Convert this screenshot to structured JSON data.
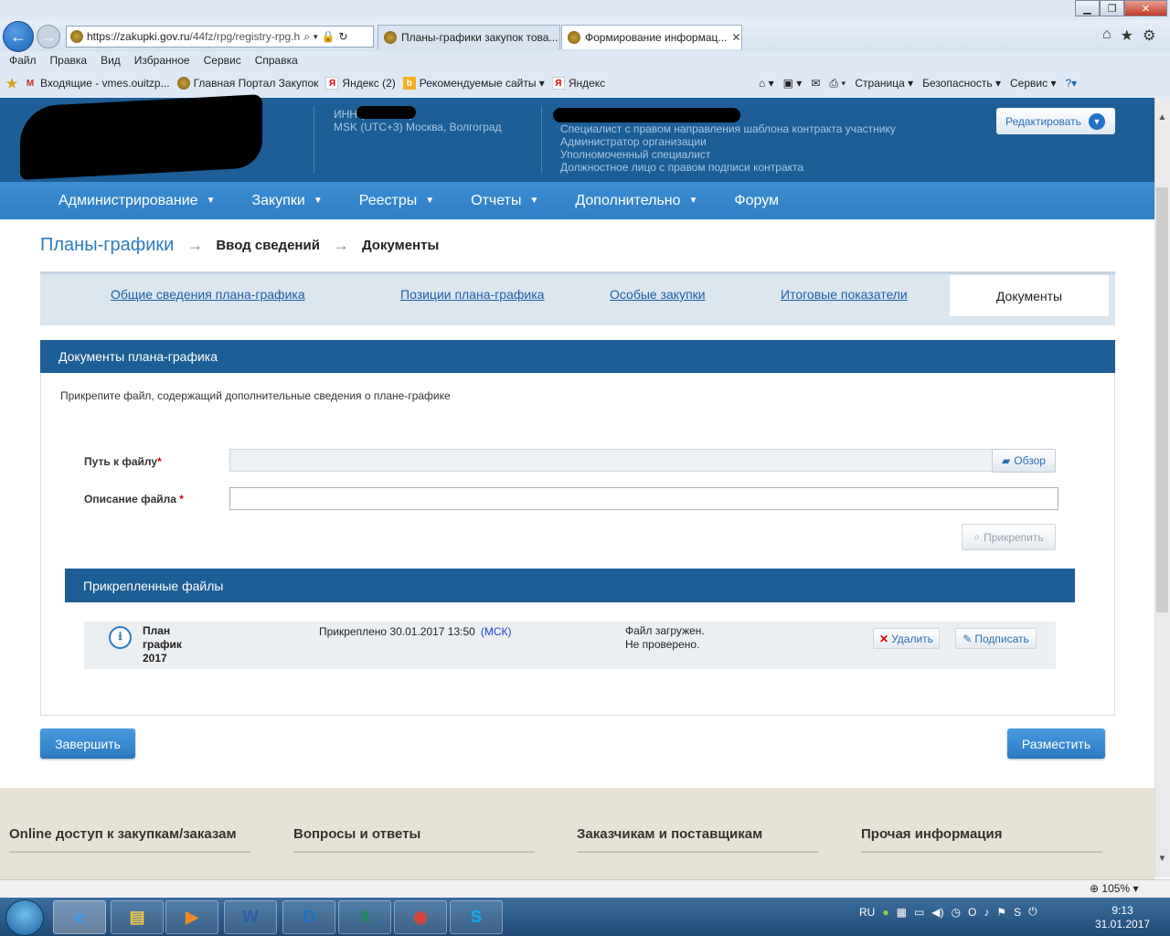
{
  "browser": {
    "url_host": "https://zakupki.gov.ru",
    "url_path": "/44fz/rpg/registry-rpg.h",
    "tabs": [
      {
        "title": "Планы-графики закупок това..."
      },
      {
        "title": "Формирование информац..."
      }
    ],
    "menu": [
      "Файл",
      "Правка",
      "Вид",
      "Избранное",
      "Сервис",
      "Справка"
    ],
    "favorites": [
      {
        "label": "Входящие - vmes.ouitzp...",
        "icon": "gmail-icon"
      },
      {
        "label": "Главная Портал Закупок",
        "icon": "emblem-icon"
      },
      {
        "label": "Яндекс (2)",
        "icon": "yandex-icon"
      },
      {
        "label": "Рекомендуемые сайты ▾",
        "icon": "bing-icon"
      },
      {
        "label": "Яндекс",
        "icon": "yandex-icon"
      }
    ],
    "commands": [
      "Страница ▾",
      "Безопасность ▾",
      "Сервис ▾"
    ],
    "zoom": "105%"
  },
  "header": {
    "org_line1": "ИНН                (Заказчик)",
    "org_line2": "MSK (UTC+3) Москва, Волгоград",
    "roles": [
      "Специалист с правом направления шаблона контракта участнику",
      "Администратор организации",
      "Уполномоченный специалист",
      "Должностное лицо с правом подписи контракта"
    ],
    "edit_label": "Редактировать"
  },
  "nav": {
    "items": [
      {
        "label": "Администрирование",
        "caret": true
      },
      {
        "label": "Закупки",
        "caret": true
      },
      {
        "label": "Реестры",
        "caret": true
      },
      {
        "label": "Отчеты",
        "caret": true
      },
      {
        "label": "Дополнительно",
        "caret": true
      },
      {
        "label": "Форум",
        "caret": false
      }
    ]
  },
  "breadcrumb": {
    "root": "Планы-графики",
    "step1": "Ввод сведений",
    "step2": "Документы"
  },
  "page_tabs": {
    "general": "Общие сведения плана-графика",
    "positions": "Позиции плана-графика",
    "special": "Особые закупки",
    "totals": "Итоговые показатели",
    "documents": "Документы"
  },
  "panel": {
    "title": "Документы плана-графика",
    "hint": "Прикрепите файл, содержащий дополнительные сведения о плане-графике",
    "file_path_label": "Путь к файлу",
    "file_desc_label": "Описание файла",
    "required_mark": "*",
    "browse_label": "Обзор",
    "attach_label": "Прикрепить",
    "attached_title": "Прикрепленные файлы"
  },
  "attached_files": [
    {
      "name": "План график 2017",
      "attached_text": "Прикреплено 30.01.2017 13:50",
      "tz": "(МСК)",
      "status": "Файл загружен. Не проверено.",
      "delete_label": "Удалить",
      "sign_label": "Подписать"
    }
  ],
  "actions": {
    "finish_label": "Завершить",
    "place_label": "Разместить"
  },
  "footer": {
    "cols": [
      "Online доступ к закупкам/заказам",
      "Вопросы и ответы",
      "Заказчикам и поставщикам",
      "Прочая информация"
    ]
  },
  "taskbar": {
    "lang": "RU",
    "time": "9:13",
    "date": "31.01.2017"
  }
}
